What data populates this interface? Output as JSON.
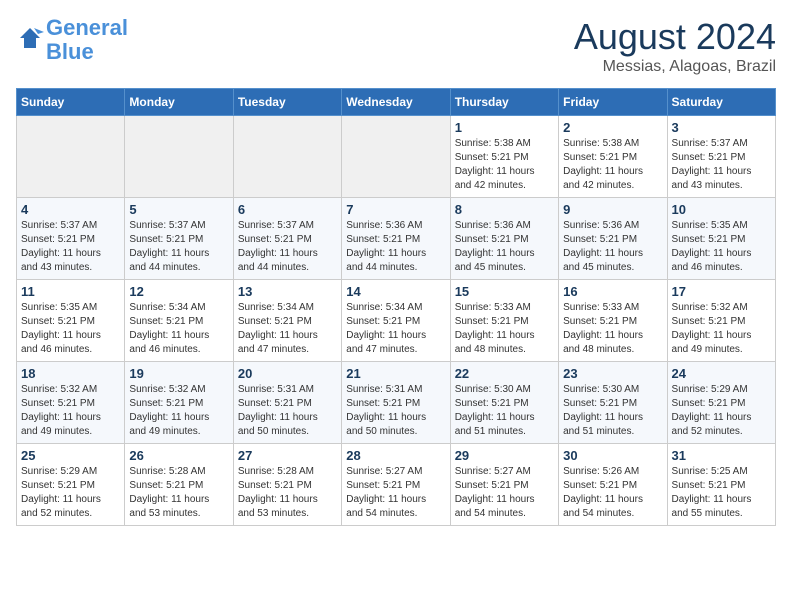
{
  "logo": {
    "line1": "General",
    "line2": "Blue"
  },
  "title": "August 2024",
  "location": "Messias, Alagoas, Brazil",
  "weekdays": [
    "Sunday",
    "Monday",
    "Tuesday",
    "Wednesday",
    "Thursday",
    "Friday",
    "Saturday"
  ],
  "weeks": [
    [
      {
        "day": "",
        "info": ""
      },
      {
        "day": "",
        "info": ""
      },
      {
        "day": "",
        "info": ""
      },
      {
        "day": "",
        "info": ""
      },
      {
        "day": "1",
        "info": "Sunrise: 5:38 AM\nSunset: 5:21 PM\nDaylight: 11 hours\nand 42 minutes."
      },
      {
        "day": "2",
        "info": "Sunrise: 5:38 AM\nSunset: 5:21 PM\nDaylight: 11 hours\nand 42 minutes."
      },
      {
        "day": "3",
        "info": "Sunrise: 5:37 AM\nSunset: 5:21 PM\nDaylight: 11 hours\nand 43 minutes."
      }
    ],
    [
      {
        "day": "4",
        "info": "Sunrise: 5:37 AM\nSunset: 5:21 PM\nDaylight: 11 hours\nand 43 minutes."
      },
      {
        "day": "5",
        "info": "Sunrise: 5:37 AM\nSunset: 5:21 PM\nDaylight: 11 hours\nand 44 minutes."
      },
      {
        "day": "6",
        "info": "Sunrise: 5:37 AM\nSunset: 5:21 PM\nDaylight: 11 hours\nand 44 minutes."
      },
      {
        "day": "7",
        "info": "Sunrise: 5:36 AM\nSunset: 5:21 PM\nDaylight: 11 hours\nand 44 minutes."
      },
      {
        "day": "8",
        "info": "Sunrise: 5:36 AM\nSunset: 5:21 PM\nDaylight: 11 hours\nand 45 minutes."
      },
      {
        "day": "9",
        "info": "Sunrise: 5:36 AM\nSunset: 5:21 PM\nDaylight: 11 hours\nand 45 minutes."
      },
      {
        "day": "10",
        "info": "Sunrise: 5:35 AM\nSunset: 5:21 PM\nDaylight: 11 hours\nand 46 minutes."
      }
    ],
    [
      {
        "day": "11",
        "info": "Sunrise: 5:35 AM\nSunset: 5:21 PM\nDaylight: 11 hours\nand 46 minutes."
      },
      {
        "day": "12",
        "info": "Sunrise: 5:34 AM\nSunset: 5:21 PM\nDaylight: 11 hours\nand 46 minutes."
      },
      {
        "day": "13",
        "info": "Sunrise: 5:34 AM\nSunset: 5:21 PM\nDaylight: 11 hours\nand 47 minutes."
      },
      {
        "day": "14",
        "info": "Sunrise: 5:34 AM\nSunset: 5:21 PM\nDaylight: 11 hours\nand 47 minutes."
      },
      {
        "day": "15",
        "info": "Sunrise: 5:33 AM\nSunset: 5:21 PM\nDaylight: 11 hours\nand 48 minutes."
      },
      {
        "day": "16",
        "info": "Sunrise: 5:33 AM\nSunset: 5:21 PM\nDaylight: 11 hours\nand 48 minutes."
      },
      {
        "day": "17",
        "info": "Sunrise: 5:32 AM\nSunset: 5:21 PM\nDaylight: 11 hours\nand 49 minutes."
      }
    ],
    [
      {
        "day": "18",
        "info": "Sunrise: 5:32 AM\nSunset: 5:21 PM\nDaylight: 11 hours\nand 49 minutes."
      },
      {
        "day": "19",
        "info": "Sunrise: 5:32 AM\nSunset: 5:21 PM\nDaylight: 11 hours\nand 49 minutes."
      },
      {
        "day": "20",
        "info": "Sunrise: 5:31 AM\nSunset: 5:21 PM\nDaylight: 11 hours\nand 50 minutes."
      },
      {
        "day": "21",
        "info": "Sunrise: 5:31 AM\nSunset: 5:21 PM\nDaylight: 11 hours\nand 50 minutes."
      },
      {
        "day": "22",
        "info": "Sunrise: 5:30 AM\nSunset: 5:21 PM\nDaylight: 11 hours\nand 51 minutes."
      },
      {
        "day": "23",
        "info": "Sunrise: 5:30 AM\nSunset: 5:21 PM\nDaylight: 11 hours\nand 51 minutes."
      },
      {
        "day": "24",
        "info": "Sunrise: 5:29 AM\nSunset: 5:21 PM\nDaylight: 11 hours\nand 52 minutes."
      }
    ],
    [
      {
        "day": "25",
        "info": "Sunrise: 5:29 AM\nSunset: 5:21 PM\nDaylight: 11 hours\nand 52 minutes."
      },
      {
        "day": "26",
        "info": "Sunrise: 5:28 AM\nSunset: 5:21 PM\nDaylight: 11 hours\nand 53 minutes."
      },
      {
        "day": "27",
        "info": "Sunrise: 5:28 AM\nSunset: 5:21 PM\nDaylight: 11 hours\nand 53 minutes."
      },
      {
        "day": "28",
        "info": "Sunrise: 5:27 AM\nSunset: 5:21 PM\nDaylight: 11 hours\nand 54 minutes."
      },
      {
        "day": "29",
        "info": "Sunrise: 5:27 AM\nSunset: 5:21 PM\nDaylight: 11 hours\nand 54 minutes."
      },
      {
        "day": "30",
        "info": "Sunrise: 5:26 AM\nSunset: 5:21 PM\nDaylight: 11 hours\nand 54 minutes."
      },
      {
        "day": "31",
        "info": "Sunrise: 5:25 AM\nSunset: 5:21 PM\nDaylight: 11 hours\nand 55 minutes."
      }
    ]
  ]
}
